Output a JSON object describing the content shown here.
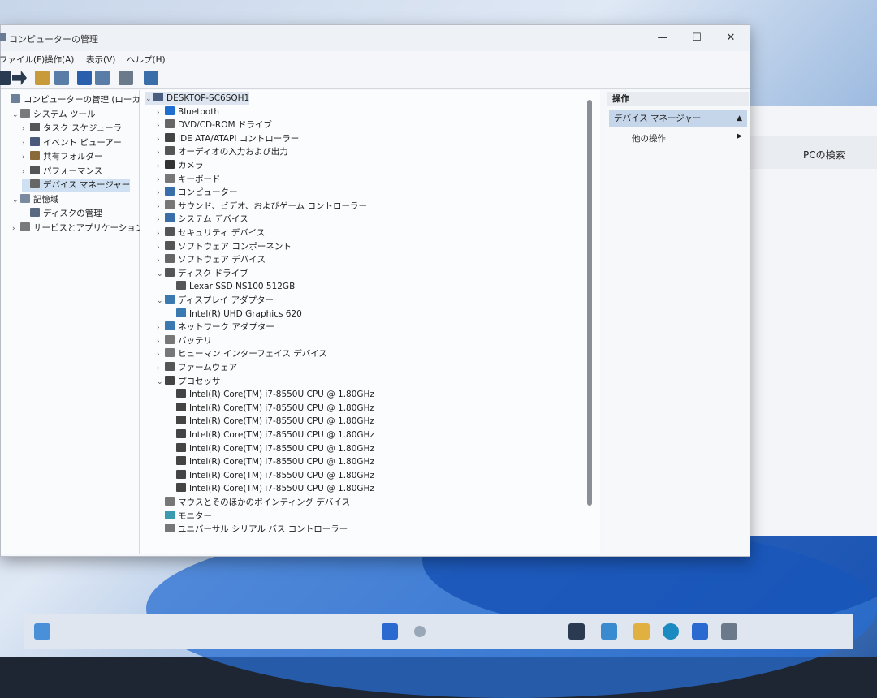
{
  "window": {
    "title": "コンピューターの管理",
    "controls": {
      "minimize": "—",
      "maximize": "☐",
      "close": "✕"
    }
  },
  "menu": [
    "ファイル(F)",
    "操作(A)",
    "表示(V)",
    "ヘルプ(H)"
  ],
  "left_tree": [
    {
      "label": "コンピューターの管理 (ローカル)",
      "level": 0,
      "chev": "",
      "icon_color": "#6d7f99"
    },
    {
      "label": "システム ツール",
      "level": 1,
      "chev": "v",
      "icon_color": "#7a7a7a"
    },
    {
      "label": "タスク スケジューラ",
      "level": 2,
      "chev": ">",
      "icon_color": "#555"
    },
    {
      "label": "イベント ビューアー",
      "level": 2,
      "chev": ">",
      "icon_color": "#4a5a7a"
    },
    {
      "label": "共有フォルダー",
      "level": 2,
      "chev": ">",
      "icon_color": "#8a6a3a"
    },
    {
      "label": "パフォーマンス",
      "level": 2,
      "chev": ">",
      "icon_color": "#555"
    },
    {
      "label": "デバイス マネージャー",
      "level": 2,
      "chev": "",
      "icon_color": "#666",
      "selected": true
    },
    {
      "label": "記憶域",
      "level": 1,
      "chev": "v",
      "icon_color": "#7a8aa0"
    },
    {
      "label": "ディスクの管理",
      "level": 2,
      "chev": "",
      "icon_color": "#5a6a80"
    },
    {
      "label": "サービスとアプリケーション",
      "level": 1,
      "chev": ">",
      "icon_color": "#7a7a7a"
    }
  ],
  "device_tree": [
    {
      "label": "DESKTOP-SC6SQH1",
      "level": 0,
      "chev": "v",
      "icon_color": "#4a5f80",
      "header": true
    },
    {
      "label": "Bluetooth",
      "level": 1,
      "chev": ">",
      "icon_color": "#1e6fd0"
    },
    {
      "label": "DVD/CD-ROM ドライブ",
      "level": 1,
      "chev": ">",
      "icon_color": "#666"
    },
    {
      "label": "IDE ATA/ATAPI コントローラー",
      "level": 1,
      "chev": ">",
      "icon_color": "#444"
    },
    {
      "label": "オーディオの入力および出力",
      "level": 1,
      "chev": ">",
      "icon_color": "#555"
    },
    {
      "label": "カメラ",
      "level": 1,
      "chev": ">",
      "icon_color": "#333"
    },
    {
      "label": "キーボード",
      "level": 1,
      "chev": ">",
      "icon_color": "#777"
    },
    {
      "label": "コンピューター",
      "level": 1,
      "chev": ">",
      "icon_color": "#3a6ea8"
    },
    {
      "label": "サウンド、ビデオ、およびゲーム コントローラー",
      "level": 1,
      "chev": ">",
      "icon_color": "#777"
    },
    {
      "label": "システム デバイス",
      "level": 1,
      "chev": ">",
      "icon_color": "#3a6ea8"
    },
    {
      "label": "セキュリティ デバイス",
      "level": 1,
      "chev": ">",
      "icon_color": "#555"
    },
    {
      "label": "ソフトウェア コンポーネント",
      "level": 1,
      "chev": ">",
      "icon_color": "#555"
    },
    {
      "label": "ソフトウェア デバイス",
      "level": 1,
      "chev": ">",
      "icon_color": "#666"
    },
    {
      "label": "ディスク ドライブ",
      "level": 1,
      "chev": "v",
      "icon_color": "#555"
    },
    {
      "label": "Lexar SSD NS100 512GB",
      "level": 2,
      "chev": "",
      "icon_color": "#555"
    },
    {
      "label": "ディスプレイ アダプター",
      "level": 1,
      "chev": "v",
      "icon_color": "#3a7ab0"
    },
    {
      "label": "Intel(R) UHD Graphics 620",
      "level": 2,
      "chev": "",
      "icon_color": "#3a7ab0"
    },
    {
      "label": "ネットワーク アダプター",
      "level": 1,
      "chev": ">",
      "icon_color": "#3a7ab0"
    },
    {
      "label": "バッテリ",
      "level": 1,
      "chev": ">",
      "icon_color": "#777"
    },
    {
      "label": "ヒューマン インターフェイス デバイス",
      "level": 1,
      "chev": ">",
      "icon_color": "#777"
    },
    {
      "label": "ファームウェア",
      "level": 1,
      "chev": ">",
      "icon_color": "#555"
    },
    {
      "label": "プロセッサ",
      "level": 1,
      "chev": "v",
      "icon_color": "#444"
    },
    {
      "label": "Intel(R) Core(TM) i7-8550U CPU @ 1.80GHz",
      "level": 2,
      "chev": "",
      "icon_color": "#444"
    },
    {
      "label": "Intel(R) Core(TM) i7-8550U CPU @ 1.80GHz",
      "level": 2,
      "chev": "",
      "icon_color": "#444"
    },
    {
      "label": "Intel(R) Core(TM) i7-8550U CPU @ 1.80GHz",
      "level": 2,
      "chev": "",
      "icon_color": "#444"
    },
    {
      "label": "Intel(R) Core(TM) i7-8550U CPU @ 1.80GHz",
      "level": 2,
      "chev": "",
      "icon_color": "#444"
    },
    {
      "label": "Intel(R) Core(TM) i7-8550U CPU @ 1.80GHz",
      "level": 2,
      "chev": "",
      "icon_color": "#444"
    },
    {
      "label": "Intel(R) Core(TM) i7-8550U CPU @ 1.80GHz",
      "level": 2,
      "chev": "",
      "icon_color": "#444"
    },
    {
      "label": "Intel(R) Core(TM) i7-8550U CPU @ 1.80GHz",
      "level": 2,
      "chev": "",
      "icon_color": "#444"
    },
    {
      "label": "Intel(R) Core(TM) i7-8550U CPU @ 1.80GHz",
      "level": 2,
      "chev": "",
      "icon_color": "#444"
    },
    {
      "label": "マウスとそのほかのポインティング デバイス",
      "level": 1,
      "chev": "",
      "icon_color": "#777"
    },
    {
      "label": "モニター",
      "level": 1,
      "chev": "",
      "icon_color": "#3a9ab0"
    },
    {
      "label": "ユニバーサル シリアル バス コントローラー",
      "level": 1,
      "chev": "",
      "icon_color": "#777"
    }
  ],
  "actions": {
    "title": "操作",
    "device_manager": "デバイス マネージャー",
    "other_ops": "他の操作",
    "collapse_arrow": "▲",
    "more_arrow": "▶"
  },
  "background_window": {
    "search": "PCの検索"
  }
}
